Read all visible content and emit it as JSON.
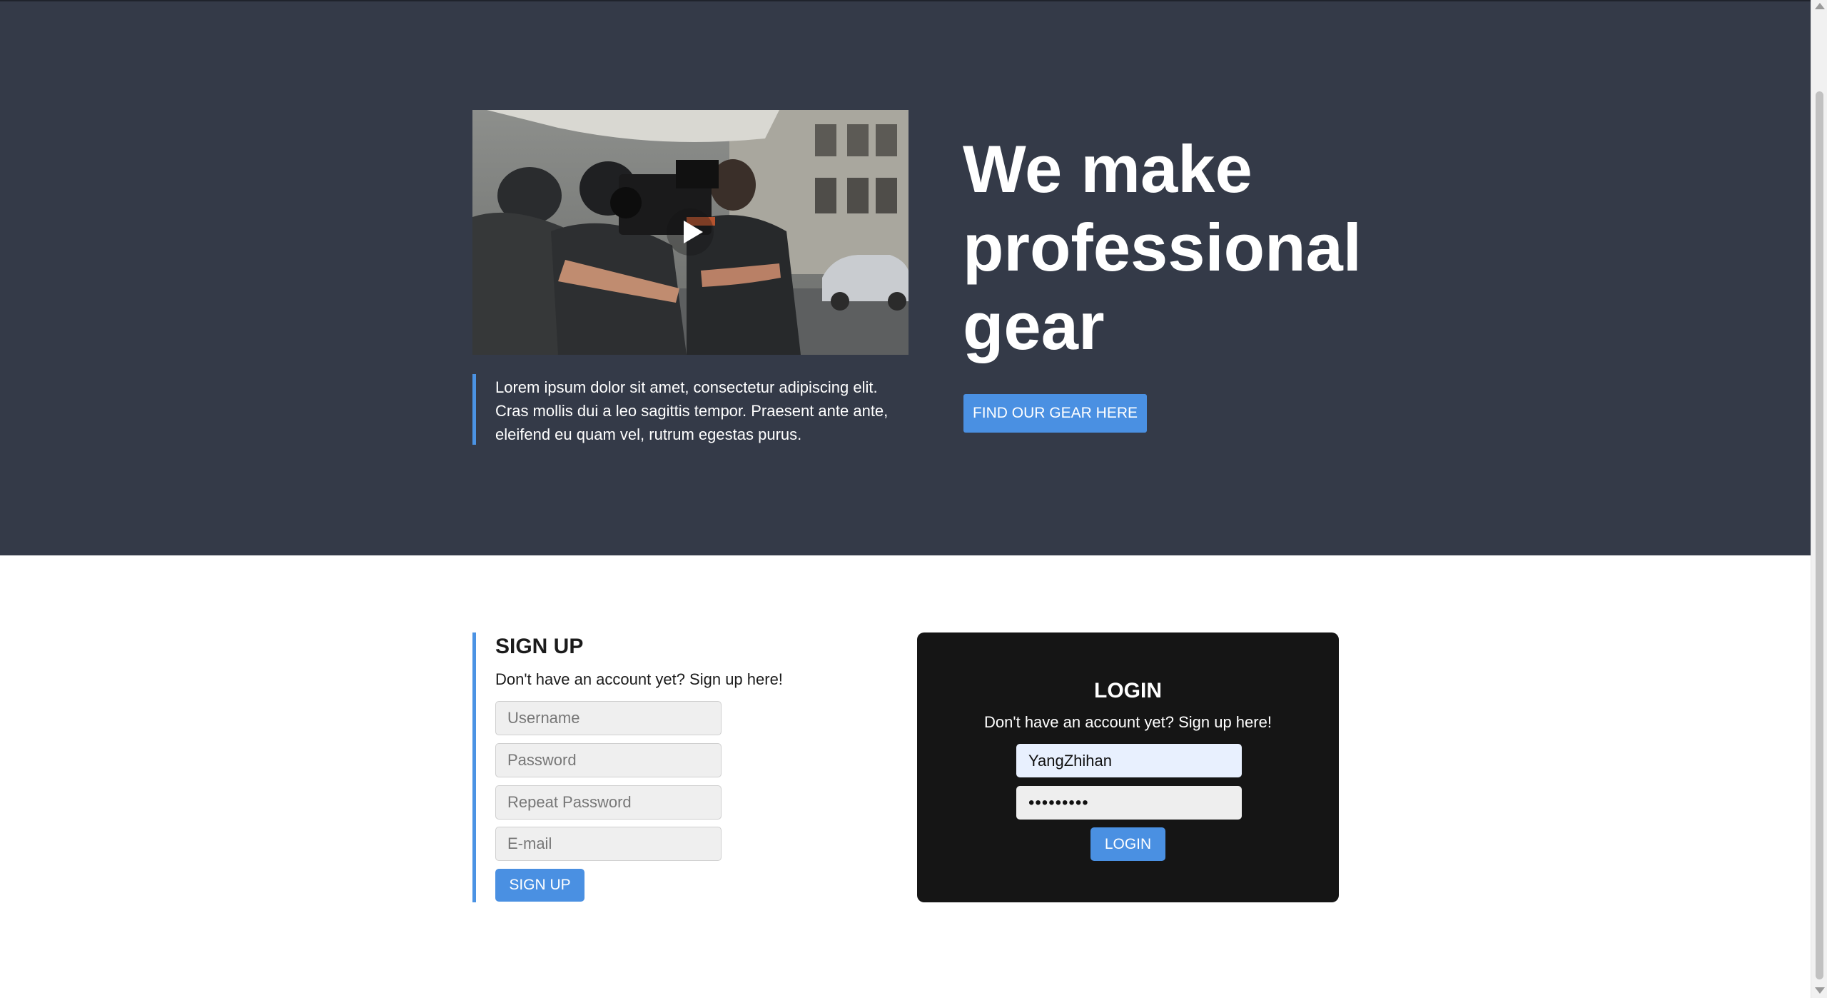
{
  "hero": {
    "video": {
      "thumbnail_description": "film crew with cinema camera on a city street",
      "play_icon": "play-icon"
    },
    "quote": "Lorem ipsum dolor sit amet, consectetur adipiscing elit. Cras mollis dui a leo sagittis tempor. Praesent ante ante, eleifend eu quam vel, rutrum egestas purus.",
    "title_lines": [
      "We make",
      "professional",
      "gear"
    ],
    "cta_label": "FIND OUR GEAR HERE"
  },
  "signup": {
    "title": "SIGN UP",
    "subtitle": "Don't have an account yet? Sign up here!",
    "username_placeholder": "Username",
    "password_placeholder": "Password",
    "repeat_password_placeholder": "Repeat Password",
    "email_placeholder": "E-mail",
    "button_label": "SIGN UP"
  },
  "login": {
    "title": "LOGIN",
    "subtitle": "Don't have an account yet? Sign up here!",
    "username_value": "YangZhihan",
    "password_value": "•••••••••",
    "button_label": "LOGIN"
  },
  "colors": {
    "hero_bg": "#343a48",
    "accent": "#4a90e2",
    "login_bg": "#151515",
    "text_light": "#ffffff"
  }
}
